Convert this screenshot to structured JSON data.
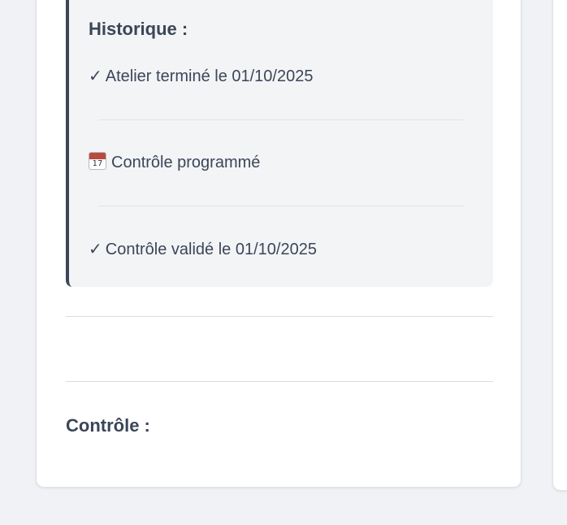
{
  "history": {
    "title": "Historique :",
    "items": [
      {
        "icon": "check-icon",
        "glyph": "✓",
        "text": "Atelier terminé le 01/10/2025"
      },
      {
        "icon": "calendar-icon",
        "day": "17",
        "text": "Contrôle programmé"
      },
      {
        "icon": "check-icon",
        "glyph": "✓",
        "text": "Contrôle validé le 01/10/2025"
      }
    ]
  },
  "control": {
    "title": "Contrôle :"
  },
  "colors": {
    "text": "#3b4658",
    "accent_border": "#3b4658",
    "history_bg": "#f3f4f6",
    "page_bg": "#f0f2f5",
    "calendar_red": "#b94a3f"
  }
}
